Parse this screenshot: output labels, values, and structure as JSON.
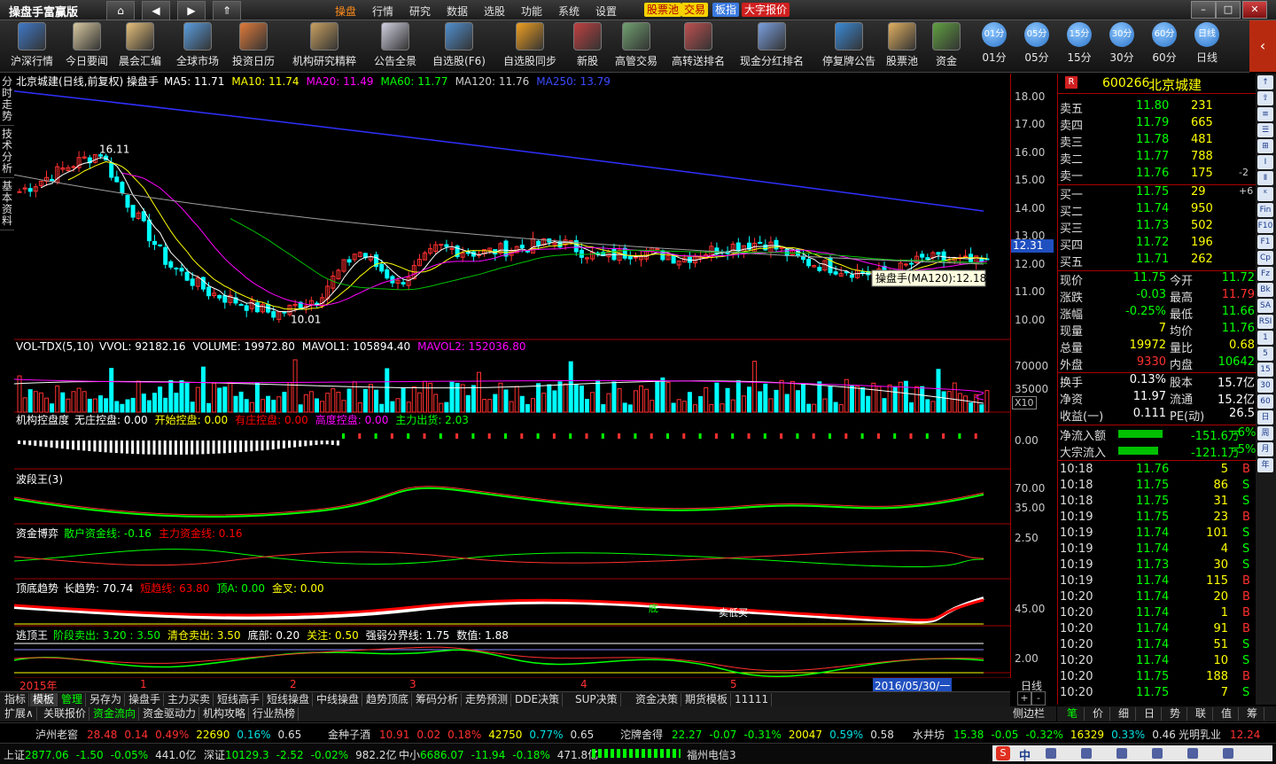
{
  "app": {
    "title": "操盘手富赢版"
  },
  "menu": [
    "操盘",
    "行情",
    "研究",
    "数据",
    "选股",
    "功能",
    "系统",
    "设置"
  ],
  "tags": [
    {
      "label": "股票池",
      "bg": "#f5d300",
      "fg": "#b00000"
    },
    {
      "label": "交易",
      "bg": "#f5d300",
      "fg": "#b00000"
    },
    {
      "label": "板指",
      "bg": "#3b7ae0",
      "fg": "#ffffff"
    },
    {
      "label": "大字报价",
      "bg": "#d02020",
      "fg": "#ffffff"
    }
  ],
  "toolbar": [
    "沪深行情",
    "今日要闻",
    "晨会汇编",
    "全球市场",
    "投资日历",
    "机构研究精粹",
    "公告全景",
    "自选股(F6)",
    "自选股同步",
    "新股",
    "高管交易",
    "高转送排名",
    "现金分红排名",
    "停复牌公告",
    "股票池",
    "资金"
  ],
  "periods": [
    "01分",
    "05分",
    "15分",
    "30分",
    "60分",
    "日线"
  ],
  "left_tabs": [
    "分时走势",
    "技术分析",
    "基本资料"
  ],
  "main_chart": {
    "title": "北京城建(日线,前复权) 操盘手",
    "ma": [
      {
        "label": "MA5: 11.71",
        "color": "#ffffff"
      },
      {
        "label": "MA10: 11.74",
        "color": "#ffff00"
      },
      {
        "label": "MA20: 11.49",
        "color": "#ff00ff"
      },
      {
        "label": "MA60: 11.77",
        "color": "#00ff00"
      },
      {
        "label": "MA120: 11.76",
        "color": "#cccccc"
      },
      {
        "label": "MA250: 13.79",
        "color": "#3b4bff"
      }
    ],
    "y_ticks": [
      "18.00",
      "17.00",
      "16.00",
      "15.00",
      "14.00",
      "13.00",
      "12.00",
      "11.00",
      "10.00"
    ],
    "high_label": "16.11",
    "low_label": "10.01",
    "cursor_price": "12.31",
    "tooltip": "操盘手(MA120):12.18"
  },
  "volume_panel": {
    "title": "VOL-TDX(5,10)",
    "items": [
      {
        "label": "VVOL: 92182.16",
        "color": "#ffffff"
      },
      {
        "label": "VOLUME: 19972.80",
        "color": "#ffffff"
      },
      {
        "label": "MAVOL1: 105894.40",
        "color": "#ffffff"
      },
      {
        "label": "MAVOL2: 152036.80",
        "color": "#ff00ff"
      }
    ],
    "y_ticks": [
      "70000",
      "35000"
    ],
    "unit": "X10"
  },
  "control_panel": {
    "title": "机构控盘度",
    "items": [
      {
        "label": "无庄控盘: 0.00",
        "color": "#ffffff"
      },
      {
        "label": "开始控盘: 0.00",
        "color": "#ffff00"
      },
      {
        "label": "有庄控盘: 0.00",
        "color": "#ff0000"
      },
      {
        "label": "高度控盘: 0.00",
        "color": "#ff00ff"
      },
      {
        "label": "主力出货: 2.03",
        "color": "#00ff00"
      }
    ],
    "y_tick": "0.00"
  },
  "wave_panel": {
    "title": "波段王(3)",
    "y_ticks": [
      "70.00",
      "35.00"
    ]
  },
  "fund_panel": {
    "title": "资金博弈",
    "items": [
      {
        "label": "散户资金线: -0.16",
        "color": "#00ff00"
      },
      {
        "label": "主力资金线: 0.16",
        "color": "#ff0000"
      }
    ],
    "y_tick": "2.50"
  },
  "trend_panel": {
    "title": "顶底趋势",
    "items": [
      {
        "label": "长趋势: 70.74",
        "color": "#ffffff"
      },
      {
        "label": "短趋线: 63.80",
        "color": "#ff0000"
      },
      {
        "label": "顶A: 0.00",
        "color": "#00ff00"
      },
      {
        "label": "金叉: 0.00",
        "color": "#ffff00"
      }
    ],
    "y_tick": "45.00",
    "annotations": [
      "底",
      "卖低买"
    ]
  },
  "escape_panel": {
    "title": "逃顶王",
    "items": [
      {
        "label": "阶段卖出: 3.20 : 3.50",
        "color": "#00ff00"
      },
      {
        "label": "清仓卖出: 3.50",
        "color": "#ffff00"
      },
      {
        "label": "底部: 0.20",
        "color": "#ffffff"
      },
      {
        "label": "关注: 0.50",
        "color": "#ffff00"
      },
      {
        "label": "强弱分界线: 1.75",
        "color": "#ffffff"
      },
      {
        "label": "数值: 1.88",
        "color": "#ffffff"
      }
    ],
    "y_tick": "2.00"
  },
  "date_axis": {
    "labels": [
      "2015年",
      "1",
      "2",
      "3",
      "4",
      "5"
    ],
    "cursor_date": "2016/05/30/一",
    "period": "日线"
  },
  "bottom_tabs": [
    "指标",
    "模板",
    "管理",
    "另存为",
    "操盘手",
    "主力买卖",
    "短线高手",
    "短线操盘",
    "中线操盘",
    "趋势顶底",
    "筹码分析",
    "走势预测",
    "DDE决策",
    "SUP决策",
    "资金决策",
    "期货模板",
    "11111"
  ],
  "bottom_tabs2": [
    "扩展∧",
    "关联报价",
    "资金流向",
    "资金驱动力",
    "机构攻略",
    "行业热榜"
  ],
  "side_label": "侧边栏<",
  "quote": {
    "code": "600266",
    "name": "北京城建",
    "sell": [
      {
        "label": "卖五",
        "price": "11.80",
        "vol": "231",
        "chg": ""
      },
      {
        "label": "卖四",
        "price": "11.79",
        "vol": "665",
        "chg": ""
      },
      {
        "label": "卖三",
        "price": "11.78",
        "vol": "481",
        "chg": ""
      },
      {
        "label": "卖二",
        "price": "11.77",
        "vol": "788",
        "chg": ""
      },
      {
        "label": "卖一",
        "price": "11.76",
        "vol": "175",
        "chg": "-2"
      }
    ],
    "buy": [
      {
        "label": "买一",
        "price": "11.75",
        "vol": "29",
        "chg": "+6"
      },
      {
        "label": "买二",
        "price": "11.74",
        "vol": "950",
        "chg": ""
      },
      {
        "label": "买三",
        "price": "11.73",
        "vol": "502",
        "chg": ""
      },
      {
        "label": "买四",
        "price": "11.72",
        "vol": "196",
        "chg": ""
      },
      {
        "label": "买五",
        "price": "11.71",
        "vol": "262",
        "chg": ""
      }
    ],
    "stats": [
      {
        "l1": "现价",
        "v1": "11.75",
        "c1": "#00ff00",
        "l2": "今开",
        "v2": "11.72",
        "c2": "#00ff00"
      },
      {
        "l1": "涨跌",
        "v1": "-0.03",
        "c1": "#00ff00",
        "l2": "最高",
        "v2": "11.79",
        "c2": "#ff3030"
      },
      {
        "l1": "涨幅",
        "v1": "-0.25%",
        "c1": "#00ff00",
        "l2": "最低",
        "v2": "11.66",
        "c2": "#00ff00"
      },
      {
        "l1": "现量",
        "v1": "7",
        "c1": "#ffff00",
        "l2": "均价",
        "v2": "11.76",
        "c2": "#00ff00"
      },
      {
        "l1": "总量",
        "v1": "19972",
        "c1": "#ffff00",
        "l2": "量比",
        "v2": "0.68",
        "c2": "#ffff00"
      },
      {
        "l1": "外盘",
        "v1": "9330",
        "c1": "#ff3030",
        "l2": "内盘",
        "v2": "10642",
        "c2": "#00ff00"
      }
    ],
    "stats2": [
      {
        "l1": "换手",
        "v1": "0.13%",
        "c1": "#ffffff",
        "l2": "股本",
        "v2": "15.7亿",
        "c2": "#ffffff"
      },
      {
        "l1": "净资",
        "v1": "11.97",
        "c1": "#ffffff",
        "l2": "流通",
        "v2": "15.2亿",
        "c2": "#ffffff"
      },
      {
        "l1": "收益(一)",
        "v1": "0.111",
        "c1": "#ffffff",
        "l2": "PE(动)",
        "v2": "26.5",
        "c2": "#ffffff"
      }
    ],
    "flows": [
      {
        "label": "净流入额",
        "value": "-151.6万",
        "pct": "-6%",
        "bar": 0.55
      },
      {
        "label": "大宗流入",
        "value": "-121.1万",
        "pct": "-5%",
        "bar": 0.5
      }
    ],
    "ticks": [
      {
        "t": "10:18",
        "p": "11.76",
        "v": "5",
        "d": "B"
      },
      {
        "t": "10:18",
        "p": "11.75",
        "v": "86",
        "d": "S"
      },
      {
        "t": "10:18",
        "p": "11.75",
        "v": "31",
        "d": "S"
      },
      {
        "t": "10:19",
        "p": "11.75",
        "v": "23",
        "d": "B"
      },
      {
        "t": "10:19",
        "p": "11.74",
        "v": "101",
        "d": "S"
      },
      {
        "t": "10:19",
        "p": "11.74",
        "v": "4",
        "d": "S"
      },
      {
        "t": "10:19",
        "p": "11.73",
        "v": "30",
        "d": "S"
      },
      {
        "t": "10:19",
        "p": "11.74",
        "v": "115",
        "d": "B"
      },
      {
        "t": "10:20",
        "p": "11.74",
        "v": "20",
        "d": "B"
      },
      {
        "t": "10:20",
        "p": "11.74",
        "v": "1",
        "d": "B"
      },
      {
        "t": "10:20",
        "p": "11.74",
        "v": "91",
        "d": "B"
      },
      {
        "t": "10:20",
        "p": "11.74",
        "v": "51",
        "d": "S"
      },
      {
        "t": "10:20",
        "p": "11.74",
        "v": "10",
        "d": "S"
      },
      {
        "t": "10:20",
        "p": "11.75",
        "v": "188",
        "d": "B"
      },
      {
        "t": "10:20",
        "p": "11.75",
        "v": "7",
        "d": "S"
      }
    ],
    "bottom_tabs": [
      "笔",
      "价",
      "细",
      "日",
      "势",
      "联",
      "值",
      "筹"
    ]
  },
  "right_strip": [
    "↑",
    "⇧",
    "≡",
    "☰",
    "⊞",
    "Ⅰ",
    "Ⅱ",
    "ᴷ",
    "Fin",
    "F10",
    "F1",
    "Cp",
    "Fz",
    "Bk",
    "SA",
    "RSI",
    "1",
    "5",
    "15",
    "30",
    "60",
    "日",
    "周",
    "月",
    "年"
  ],
  "ticker": [
    {
      "name": "泸州老窖",
      "price": "28.48",
      "chg": "0.14",
      "pct": "0.49%",
      "vol": "22690",
      "turn": "0.16%",
      "x": "0.65"
    },
    {
      "name": "金种子酒",
      "price": "10.91",
      "chg": "0.02",
      "pct": "0.18%",
      "vol": "42750",
      "turn": "0.77%",
      "x": "0.65"
    },
    {
      "name": "沱牌舍得",
      "price": "22.27",
      "chg": "-0.07",
      "pct": "-0.31%",
      "vol": "20047",
      "turn": "0.59%",
      "x": "0.58"
    },
    {
      "name": "水井坊",
      "price": "15.38",
      "chg": "-0.05",
      "pct": "-0.32%",
      "vol": "16329",
      "turn": "0.33%",
      "x": "0.46"
    },
    {
      "name": "光明乳业",
      "price": "12.24",
      "chg": "",
      "pct": "",
      "vol": "",
      "turn": "",
      "x": ""
    }
  ],
  "status": [
    {
      "name": "上证",
      "val": "2877.06",
      "chg": "-1.50",
      "pct": "-0.05%",
      "amt": "441.0亿"
    },
    {
      "name": "深证",
      "val": "10129.3",
      "chg": "-2.52",
      "pct": "-0.02%",
      "amt": "982.2亿"
    },
    {
      "name": "中小",
      "val": "6686.07",
      "chg": "-11.94",
      "pct": "-0.18%",
      "amt": "471.8亿"
    }
  ],
  "status_right": "福州电信3",
  "tray_text": "中"
}
